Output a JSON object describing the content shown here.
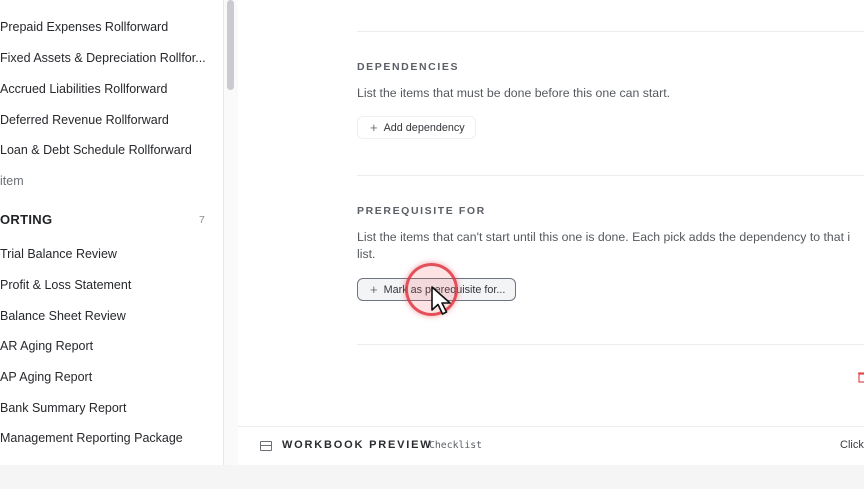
{
  "sidebar": {
    "items_top": [
      {
        "label": "Prepaid Expenses Rollforward"
      },
      {
        "label": "Fixed Assets & Depreciation Rollfor..."
      },
      {
        "label": "Accrued Liabilities Rollforward"
      },
      {
        "label": "Deferred Revenue Rollforward"
      },
      {
        "label": "Loan & Debt Schedule Rollforward"
      }
    ],
    "add_item_label": "item",
    "section": {
      "title": "ORTING",
      "count": "7"
    },
    "items_reporting": [
      {
        "label": "Trial Balance Review"
      },
      {
        "label": "Profit & Loss Statement"
      },
      {
        "label": "Balance Sheet Review"
      },
      {
        "label": "AR Aging Report"
      },
      {
        "label": "AP Aging Report"
      },
      {
        "label": "Bank Summary Report"
      },
      {
        "label": "Management Reporting Package"
      }
    ]
  },
  "dependencies": {
    "label": "DEPENDENCIES",
    "description": "List the items that must be done before this one can start.",
    "button_label": "Add dependency"
  },
  "prerequisite": {
    "label": "PREREQUISITE FOR",
    "description": "List the items that can't start until this one is done. Each pick adds the dependency to that i list.",
    "button_label": "Mark as prerequisite for..."
  },
  "footer": {
    "title": "WORKBOOK PREVIEW",
    "tag": "Checklist",
    "right_text": "Click"
  },
  "colors": {
    "accent_click": "#e13741",
    "delete_red": "#e0474c"
  },
  "icons": [
    "plus-icon",
    "trash-icon",
    "table-icon",
    "mouse-cursor-icon"
  ]
}
